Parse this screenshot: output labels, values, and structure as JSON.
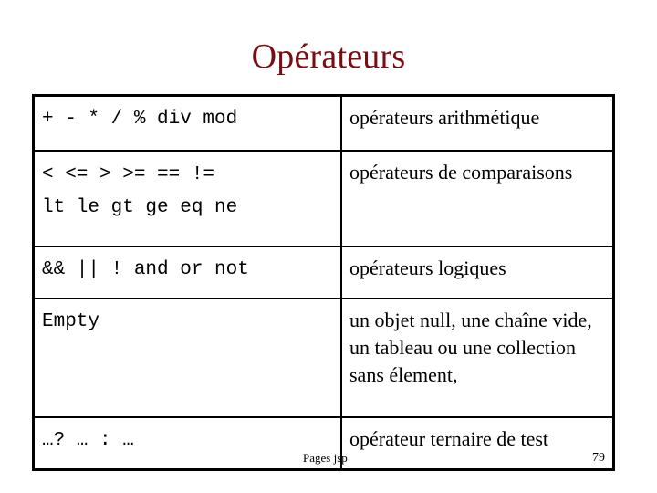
{
  "slide": {
    "title": "Opérateurs",
    "title_color": "#7b0c12",
    "page_number": "79",
    "footer_label": "Pages jsp"
  },
  "table": {
    "rows": [
      {
        "syntax_lines": [
          "+ - * / % div mod"
        ],
        "description": "opérateurs arithmétique"
      },
      {
        "syntax_lines": [
          "< <= > >= == !=",
          "lt le gt ge eq ne"
        ],
        "description": "opérateurs de comparaisons"
      },
      {
        "syntax_lines": [
          "&& || ! and or not"
        ],
        "description": "opérateurs logiques"
      },
      {
        "syntax_lines": [
          "Empty"
        ],
        "description": "un objet null, une chaîne vide, un tableau ou une collection sans élement,"
      },
      {
        "syntax_lines": [
          "…? … : …"
        ],
        "description": "opérateur ternaire de test"
      }
    ]
  }
}
